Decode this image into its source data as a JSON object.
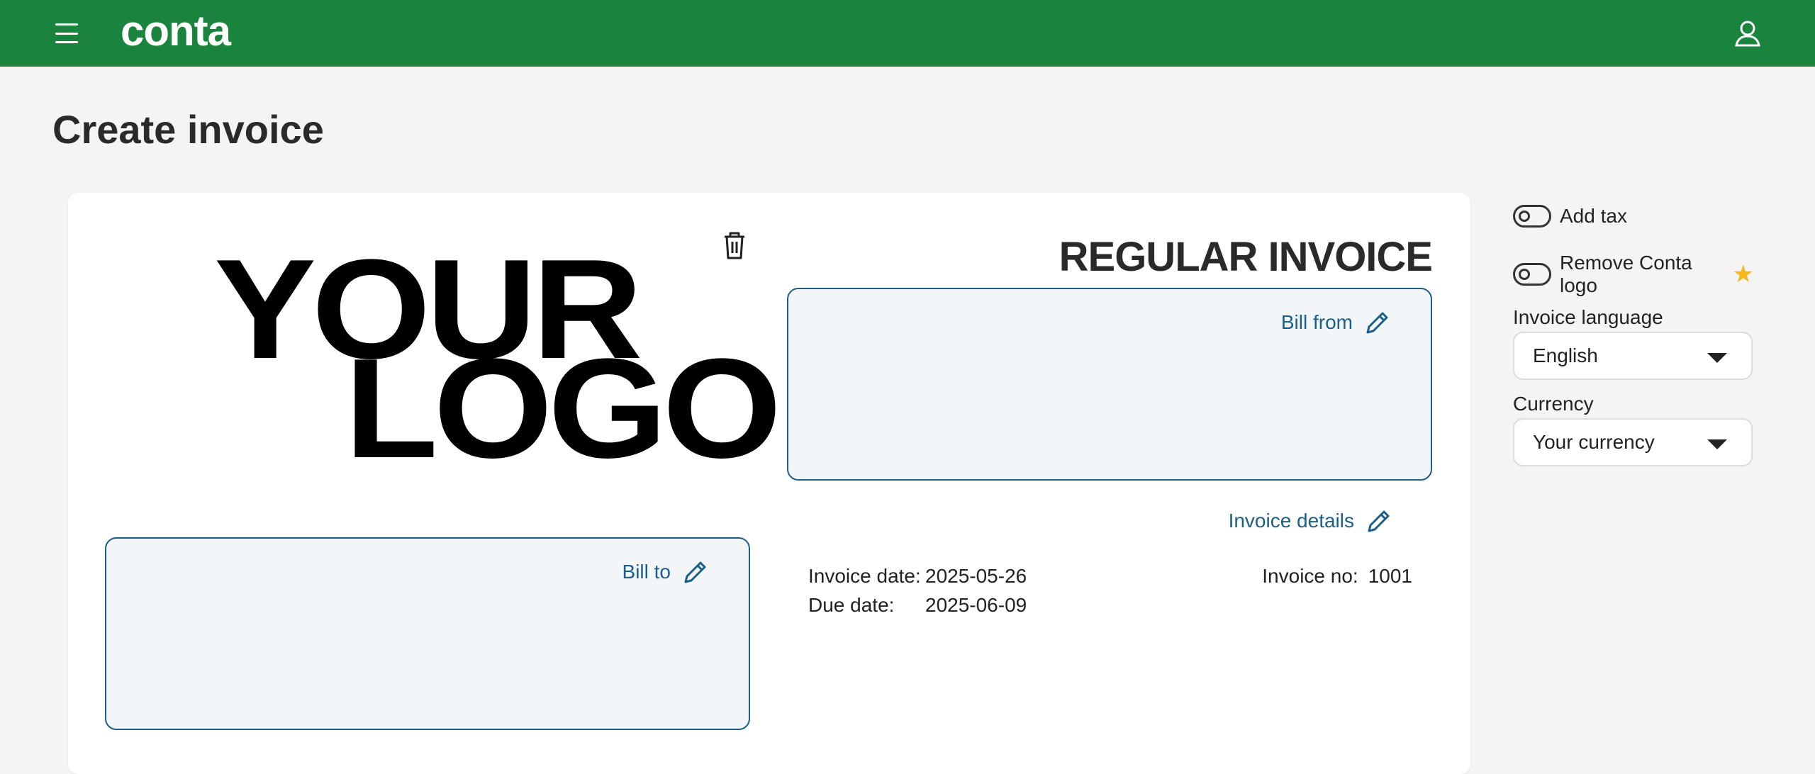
{
  "header": {
    "brand": "conta",
    "brand_color": "#1a843e"
  },
  "page": {
    "title": "Create invoice"
  },
  "invoice": {
    "logo_line1": "YOUR",
    "logo_line2": "LOGO",
    "type_title": "REGULAR INVOICE",
    "bill_from_label": "Bill from",
    "bill_to_label": "Bill to",
    "details_label": "Invoice details",
    "invoice_date_label": "Invoice date:",
    "invoice_date": "2025-05-26",
    "due_date_label": "Due date:",
    "due_date": "2025-06-09",
    "invoice_no_label": "Invoice no:",
    "invoice_no": "1001"
  },
  "sidebar": {
    "add_tax_label": "Add tax",
    "remove_logo_label": "Remove Conta logo",
    "language_label": "Invoice language",
    "language_value": "English",
    "currency_label": "Currency",
    "currency_value": "Your currency"
  },
  "icons": {
    "menu": "hamburger-menu-icon",
    "user": "user-icon",
    "trash": "trash-icon",
    "edit": "pencil-icon",
    "premium": "star-icon"
  },
  "colors": {
    "link": "#1a5f8a",
    "box_border": "#1f5f87",
    "box_fill": "#f3f6f9",
    "star": "#f5b81d"
  }
}
